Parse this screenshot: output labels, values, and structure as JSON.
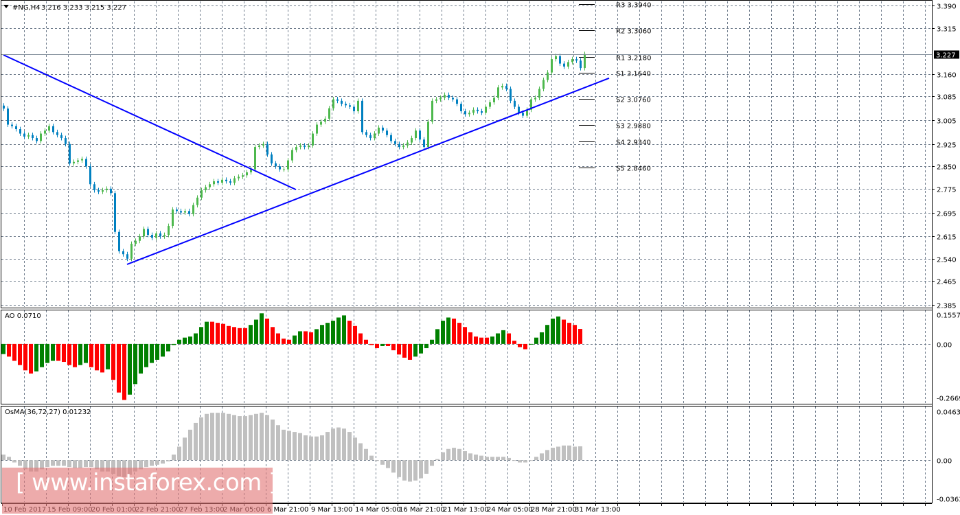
{
  "header": {
    "symbol_label": "#NG,H4",
    "ohlc_label": "3.216 3.233 3.215 3.227"
  },
  "watermark": "[ www.instaforex.com ]",
  "colors": {
    "bull": "#4db84d",
    "bear": "#0080c0",
    "trendline": "#0000ff",
    "ao_up": "#008000",
    "ao_down": "#ff0000",
    "osma": "#c0c0c0",
    "grid": "#6e7b8b"
  },
  "time_axis": [
    "10 Feb 2017",
    "15 Feb 09:00",
    "20 Feb 01:00",
    "22 Feb 21:00",
    "27 Feb 13:00",
    "2 Mar 05:00",
    "6 Mar 21:00",
    "9 Mar 13:00",
    "14 Mar 05:00",
    "16 Mar 21:00",
    "21 Mar 13:00",
    "24 Mar 05:00",
    "28 Mar 21:00",
    "31 Mar 13:00"
  ],
  "chart_data": [
    {
      "type": "candlestick",
      "panel": "price",
      "ylim": [
        2.385,
        3.39
      ],
      "yticks": [
        "3.390",
        "3.315",
        "3.160",
        "3.085",
        "3.005",
        "2.925",
        "2.850",
        "2.775",
        "2.695",
        "2.615",
        "2.540",
        "2.465",
        "2.385"
      ],
      "current_price": "3.227",
      "grid": true,
      "close": [
        3.044,
        2.99,
        2.985,
        2.975,
        2.96,
        2.95,
        2.955,
        2.945,
        2.935,
        2.96,
        2.97,
        2.985,
        2.965,
        2.955,
        2.945,
        2.925,
        2.86,
        2.865,
        2.87,
        2.875,
        2.85,
        2.79,
        2.77,
        2.765,
        2.77,
        2.775,
        2.76,
        2.63,
        2.565,
        2.555,
        2.54,
        2.59,
        2.6,
        2.615,
        2.64,
        2.62,
        2.61,
        2.625,
        2.615,
        2.62,
        2.65,
        2.705,
        2.7,
        2.695,
        2.7,
        2.69,
        2.72,
        2.745,
        2.77,
        2.78,
        2.79,
        2.8,
        2.795,
        2.805,
        2.8,
        2.795,
        2.81,
        2.815,
        2.82,
        2.83,
        2.84,
        2.915,
        2.92,
        2.925,
        2.89,
        2.86,
        2.85,
        2.84,
        2.84,
        2.87,
        2.905,
        2.915,
        2.92,
        2.915,
        2.92,
        2.96,
        2.99,
        3.0,
        3.01,
        3.045,
        3.075,
        3.07,
        3.06,
        3.055,
        3.05,
        3.035,
        3.07,
        2.965,
        2.955,
        2.945,
        2.96,
        2.98,
        2.97,
        2.955,
        2.935,
        2.925,
        2.915,
        2.92,
        2.93,
        2.945,
        2.97,
        2.94,
        2.915,
        3.0,
        3.07,
        3.075,
        3.08,
        3.09,
        3.08,
        3.075,
        3.06,
        3.035,
        3.025,
        3.03,
        3.04,
        3.035,
        3.03,
        3.05,
        3.065,
        3.08,
        3.115,
        3.12,
        3.11,
        3.07,
        3.05,
        3.03,
        3.02,
        3.04,
        3.075,
        3.08,
        3.11,
        3.14,
        3.165,
        3.21,
        3.22,
        3.195,
        3.185,
        3.2,
        3.21,
        3.205,
        3.18,
        3.227
      ],
      "trendlines": [
        {
          "start_index": 0,
          "start_price": 3.224,
          "end_index": 71,
          "end_price": 2.772
        },
        {
          "start_index": 30,
          "start_price": 2.521,
          "end_index": 147,
          "end_price": 3.146
        }
      ],
      "pivots": [
        {
          "name": "R3",
          "value": "3.3940",
          "label": "R3 3.3940"
        },
        {
          "name": "R2",
          "value": "3.3060",
          "label": "R2 3.3060"
        },
        {
          "name": "R1",
          "value": "3.2180",
          "label": "R1 3.2180"
        },
        {
          "name": "S1",
          "value": "3.1640",
          "label": "S1 3.1640"
        },
        {
          "name": "S2",
          "value": "3.0760",
          "label": "S2 3.0760"
        },
        {
          "name": "S3",
          "value": "2.9880",
          "label": "S3 2.9880"
        },
        {
          "name": "S4",
          "value": "2.9340",
          "label": "S4 2.9340"
        },
        {
          "name": "S5",
          "value": "2.8460",
          "label": "S5 2.8460"
        }
      ]
    },
    {
      "type": "bar",
      "panel": "AO",
      "title": "AO 0.0710",
      "ylim": [
        -0.2669,
        0.1557
      ],
      "yticks": [
        "0.1557",
        "0.00",
        "-0.2669"
      ],
      "values": [
        -0.048,
        -0.06,
        -0.08,
        -0.1,
        -0.125,
        -0.14,
        -0.13,
        -0.11,
        -0.09,
        -0.08,
        -0.08,
        -0.085,
        -0.1,
        -0.11,
        -0.1,
        -0.09,
        -0.11,
        -0.125,
        -0.135,
        -0.12,
        -0.17,
        -0.23,
        -0.265,
        -0.24,
        -0.19,
        -0.14,
        -0.11,
        -0.09,
        -0.075,
        -0.06,
        -0.035,
        -0.005,
        0.02,
        0.03,
        0.035,
        0.05,
        0.08,
        0.105,
        0.105,
        0.1,
        0.095,
        0.085,
        0.08,
        0.075,
        0.075,
        0.09,
        0.115,
        0.145,
        0.12,
        0.08,
        0.05,
        0.025,
        0.02,
        0.04,
        0.06,
        0.06,
        0.055,
        0.07,
        0.09,
        0.1,
        0.11,
        0.125,
        0.135,
        0.11,
        0.085,
        0.05,
        0.02,
        -0.005,
        -0.02,
        -0.01,
        -0.01,
        -0.03,
        -0.05,
        -0.065,
        -0.075,
        -0.06,
        -0.045,
        -0.02,
        0.02,
        0.07,
        0.11,
        0.125,
        0.12,
        0.1,
        0.08,
        0.055,
        0.035,
        0.03,
        0.03,
        0.035,
        0.05,
        0.065,
        0.05,
        0.015,
        -0.015,
        -0.025,
        0,
        0.03,
        0.055,
        0.09,
        0.12,
        0.13,
        0.115,
        0.1,
        0.09,
        0.071
      ]
    },
    {
      "type": "bar",
      "panel": "OsMA",
      "title": "OsMA(36,72,27) 0.01232",
      "ylim": [
        -0.03637,
        0.04633
      ],
      "yticks": [
        "0.04633",
        "0.00",
        "-0.03637"
      ],
      "values": [
        0.005,
        0.003,
        -0.002,
        -0.005,
        -0.008,
        -0.01,
        -0.01,
        -0.008,
        -0.006,
        -0.005,
        -0.005,
        -0.005,
        -0.006,
        -0.007,
        -0.007,
        -0.006,
        -0.006,
        -0.008,
        -0.01,
        -0.01,
        -0.012,
        -0.014,
        -0.015,
        -0.013,
        -0.01,
        -0.008,
        -0.006,
        -0.005,
        -0.004,
        -0.003,
        -0.001,
        0.005,
        0.012,
        0.02,
        0.027,
        0.033,
        0.038,
        0.041,
        0.042,
        0.042,
        0.042,
        0.041,
        0.04,
        0.039,
        0.039,
        0.04,
        0.041,
        0.042,
        0.04,
        0.036,
        0.031,
        0.027,
        0.026,
        0.025,
        0.024,
        0.022,
        0.021,
        0.021,
        0.022,
        0.025,
        0.028,
        0.029,
        0.028,
        0.025,
        0.02,
        0.015,
        0.01,
        0.004,
        0,
        -0.004,
        -0.007,
        -0.011,
        -0.015,
        -0.018,
        -0.019,
        -0.018,
        -0.016,
        -0.012,
        -0.005,
        0.001,
        0.007,
        0.01,
        0.011,
        0.01,
        0.008,
        0.006,
        0.005,
        0.004,
        0.003,
        0.003,
        0.003,
        0.003,
        0.002,
        0,
        -0.002,
        -0.002,
        0,
        0.003,
        0.006,
        0.009,
        0.011,
        0.012,
        0.013,
        0.013,
        0.012,
        0.0123
      ]
    }
  ]
}
